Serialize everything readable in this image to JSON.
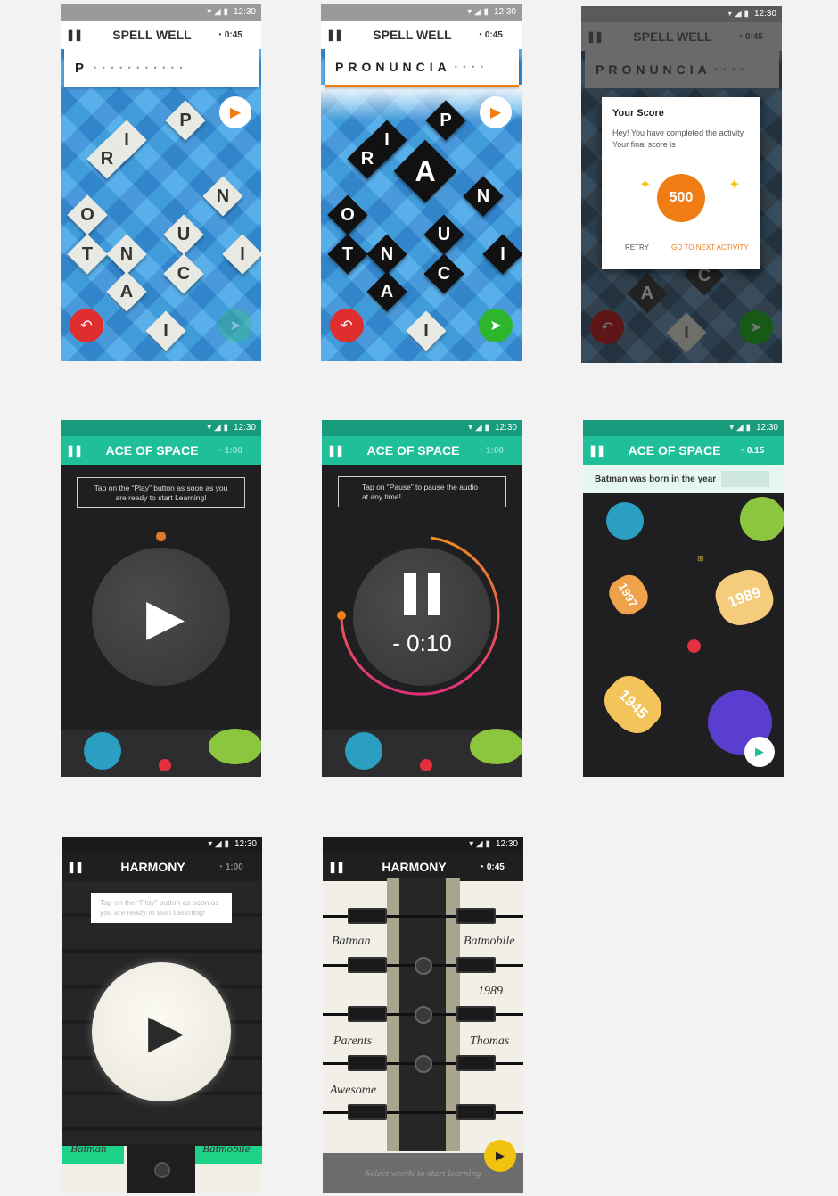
{
  "status": {
    "time": "12:30"
  },
  "colors": {
    "spell_blue": "#3aa0e0",
    "teal": "#1fbf9a",
    "orange": "#f07d13",
    "red": "#e02e2e",
    "green": "#2db52d",
    "dark": "#1f1f22"
  },
  "spell": {
    "title": "SPELL WELL",
    "timer": "0:45",
    "screen1": {
      "word": "P",
      "dots": "• • • • • • • • • • •",
      "letters": [
        "P",
        "I",
        "R",
        "N",
        "O",
        "U",
        "T",
        "N",
        "I",
        "C",
        "A",
        "I"
      ]
    },
    "screen2": {
      "word": "PRONUNCIA",
      "dots": "• • • •",
      "letters": [
        "P",
        "I",
        "R",
        "A",
        "N",
        "O",
        "U",
        "T",
        "N",
        "I",
        "C",
        "A",
        "I"
      ]
    },
    "screen3": {
      "word": "PRONUNCIA",
      "dots": "• • • •",
      "dialog_title": "Your Score",
      "dialog_body": "Hey! You have completed the activity. Your final score is",
      "score": "500",
      "retry": "RETRY",
      "next": "GO TO NEXT ACTIVITY",
      "letters": [
        "A",
        "C",
        "I"
      ]
    }
  },
  "space": {
    "title": "ACE OF SPACE",
    "screen1": {
      "timer": "1:00",
      "prompt": "Tap on the “Play” button as soon as you are ready to start Learning!"
    },
    "screen2": {
      "timer": "1:00",
      "prompt": "Tap on “Pause” to pause the audio at any time!",
      "countdown": "- 0:10"
    },
    "screen3": {
      "timer": "0.15",
      "question": "Batman was born in the year",
      "options": [
        "1997",
        "1989",
        "1945"
      ]
    }
  },
  "harmony": {
    "title": "HARMONY",
    "screen1": {
      "timer": "1:00",
      "prompt": "Tap on the “Play” button as soon as you are ready to start Learning!",
      "word_left": "Batman",
      "word_right": "Batmobile"
    },
    "screen2": {
      "timer": "0:45",
      "words_left": [
        "Batman",
        "Parents",
        "Awesome"
      ],
      "words_right": [
        "Batmobile",
        "1989",
        "Thomas"
      ],
      "footer": "Select words to start learning"
    }
  }
}
